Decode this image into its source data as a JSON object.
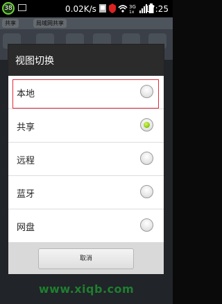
{
  "status_bar": {
    "badge": "38",
    "speed": "0.02K/s",
    "time": "17:25",
    "icons": [
      "notification-icon",
      "signal-3g-icon",
      "wifi-icon",
      "signal-bars-icon",
      "battery-icon"
    ]
  },
  "app": {
    "breadcrumb": [
      "共享",
      "局域网共享"
    ]
  },
  "dialog": {
    "title": "视图切换",
    "options": [
      {
        "label": "本地",
        "selected": false
      },
      {
        "label": "共享",
        "selected": true
      },
      {
        "label": "远程",
        "selected": false
      },
      {
        "label": "蓝牙",
        "selected": false
      },
      {
        "label": "网盘",
        "selected": false
      }
    ],
    "cancel_label": "取消"
  },
  "watermark": "www.xiqb.com",
  "colors": {
    "highlight": "#e2283a",
    "radio_checked": "#8fcf14",
    "header": "#2b2b2b",
    "watermark": "#1e7f2e"
  }
}
